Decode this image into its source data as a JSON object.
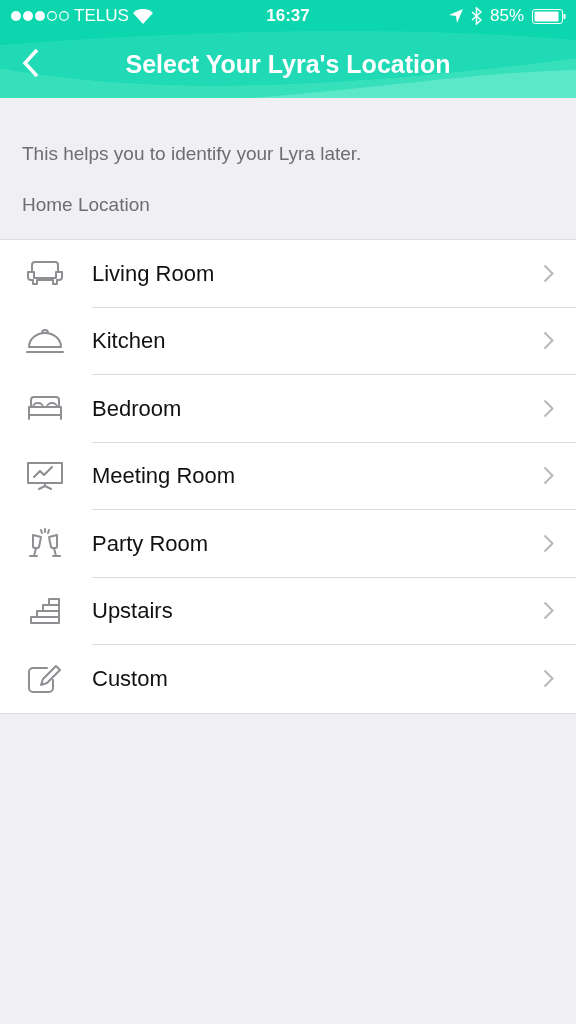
{
  "status_bar": {
    "carrier": "TELUS",
    "time": "16:37",
    "battery": "85%"
  },
  "nav": {
    "title": "Select Your Lyra's Location"
  },
  "intro": "This helps you to identify your Lyra later.",
  "section_title": "Home Location",
  "locations": [
    {
      "kind": "sofa",
      "label": "Living Room"
    },
    {
      "kind": "cloche",
      "label": "Kitchen"
    },
    {
      "kind": "bed",
      "label": "Bedroom"
    },
    {
      "kind": "board",
      "label": "Meeting Room"
    },
    {
      "kind": "glasses",
      "label": "Party Room"
    },
    {
      "kind": "stairs",
      "label": "Upstairs"
    },
    {
      "kind": "edit",
      "label": "Custom"
    }
  ]
}
